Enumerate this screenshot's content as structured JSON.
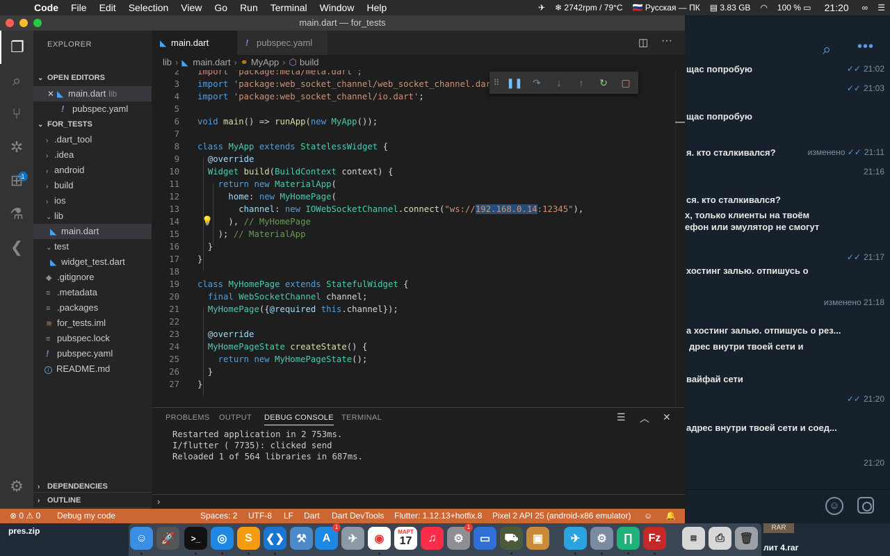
{
  "menubar": {
    "app": "Code",
    "items": [
      "File",
      "Edit",
      "Selection",
      "View",
      "Go",
      "Run",
      "Terminal",
      "Window",
      "Help"
    ],
    "fan": "2742rpm / 79°C",
    "lang": "Русская — ПК",
    "mem": "3.83 GB",
    "battery": "100 %",
    "clock": "21:20"
  },
  "window": {
    "title": "main.dart — for_tests"
  },
  "sidebar": {
    "title": "EXPLORER",
    "open_editors": "OPEN EDITORS",
    "open_items": [
      {
        "name": "main.dart",
        "hint": "lib"
      },
      {
        "name": "pubspec.yaml"
      }
    ],
    "project": "FOR_TESTS",
    "tree": [
      ".dart_tool",
      ".idea",
      "android",
      "build",
      "ios",
      "lib",
      "main.dart",
      "test",
      "widget_test.dart",
      ".gitignore",
      ".metadata",
      ".packages",
      "for_tests.iml",
      "pubspec.lock",
      "pubspec.yaml",
      "README.md"
    ],
    "outline": "OUTLINE",
    "dependencies": "DEPENDENCIES"
  },
  "activity": {
    "debug_badge": "1"
  },
  "tabs": {
    "main": "main.dart",
    "pubspec": "pubspec.yaml"
  },
  "breadcrumb": {
    "folder": "lib",
    "file": "main.dart",
    "class": "MyApp",
    "method": "build"
  },
  "editor": {
    "line_numbers": [
      "2",
      "3",
      "4",
      "5",
      "6",
      "7",
      "8",
      "9",
      "10",
      "11",
      "12",
      "13",
      "14",
      "15",
      "16",
      "17",
      "18",
      "19",
      "20",
      "21",
      "22",
      "23",
      "24",
      "25",
      "26",
      "27"
    ],
    "lines": {
      "l2": "import 'package:meta/meta.dart';",
      "l3_kw": "import",
      "l3_st": "'package:web_socket_channel/web_socket_channel.dart'",
      "l4_kw": "import",
      "l4_st": "'package:web_socket_channel/io.dart'",
      "l6_kw": "void",
      "l6_fn": "main",
      "l6_mid": "() => ",
      "l6_fn2": "runApp",
      "l6_kw2": "new",
      "l6_ty": "MyApp",
      "l8_kw": "class",
      "l8_ty": "MyApp",
      "l8_kw2": "extends",
      "l8_ty2": "StatelessWidget",
      "l9_at": "@override",
      "l10_ty": "Widget",
      "l10_fn": "build",
      "l10_ty2": "BuildContext",
      "l10_rest": " context) {",
      "l11_kw": "return",
      "l11_kw2": "new",
      "l11_ty": "MaterialApp",
      "l12_va": "home",
      "l12_kw": "new",
      "l12_ty": "MyHomePage",
      "l13_va": "channel",
      "l13_kw": "new",
      "l13_ty": "IOWebSocketChannel",
      "l13_fn": "connect",
      "l13_st1": "\"ws://",
      "l13_sel": "192.168.0.14",
      "l13_st2": ":12345\"",
      "l14_cm": "// MyHomePage",
      "l15_cm": "// MaterialApp",
      "l19_kw": "class",
      "l19_ty": "MyHomePage",
      "l19_kw2": "extends",
      "l19_ty2": "StatefulWidget",
      "l20_kw": "final",
      "l20_ty": "WebSocketChannel",
      "l20_rest": " channel;",
      "l21_ty": "MyHomePage",
      "l21_at": "@required",
      "l21_kw": "this",
      "l21_rest": ".channel});",
      "l23_at": "@override",
      "l24_ty": "MyHomePageState",
      "l24_fn": "createState",
      "l25_kw": "return",
      "l25_kw2": "new",
      "l25_ty": "MyHomePageState"
    }
  },
  "panel": {
    "tabs": [
      "PROBLEMS",
      "OUTPUT",
      "DEBUG CONSOLE",
      "TERMINAL"
    ],
    "console": [
      "Restarted application in 2 753ms.",
      "I/flutter ( 7735): clicked send",
      "Reloaded 1 of 564 libraries in 687ms."
    ]
  },
  "statusbar": {
    "problems": "⊗ 0 ⚠ 0",
    "debug": "Debug my code",
    "spaces": "Spaces: 2",
    "encoding": "UTF-8",
    "eol": "LF",
    "language": "Dart",
    "devtools": "Dart DevTools",
    "flutter": "Flutter: 1.12.13+hotfix.8",
    "device": "Pixel 2 API 25 (android-x86 emulator)"
  },
  "telegram": {
    "messages": [
      {
        "text": "щас попробую",
        "time": "21:02",
        "check": true
      },
      {
        "text": "",
        "time": "21:03",
        "check": true
      },
      {
        "text": "щас попробую",
        "time": "",
        "check": false
      },
      {
        "text": "я. кто сталкивался?",
        "time": "21:11",
        "edited": "изменено",
        "check": true
      },
      {
        "text": "",
        "time": "21:16",
        "check": false
      },
      {
        "text": "ся. кто сталкивался?",
        "time": "",
        "check": false
      },
      {
        "text": "х, только клиенты на твоём",
        "time": "",
        "check": false
      },
      {
        "text": "ефон или эмулятор не смогут",
        "time": "",
        "check": false
      },
      {
        "text": "",
        "time": "21:17",
        "check": true
      },
      {
        "text": "хостинг залью. отпишусь о",
        "time": "",
        "check": false
      },
      {
        "text": "",
        "time": "21:18",
        "edited": "изменено",
        "check": false
      },
      {
        "text": "а хостинг залью. отпишусь о рез...",
        "time": "",
        "check": false
      },
      {
        "text": "дрес внутри твоей сети и",
        "time": "",
        "check": false
      },
      {
        "text": "вайфай сети",
        "time": "",
        "check": false
      },
      {
        "text": "",
        "time": "21:20",
        "check": true
      },
      {
        "text": "адрес внутри твоей сети и соед...",
        "time": "",
        "check": false
      },
      {
        "text": "",
        "time": "21:20",
        "check": false
      }
    ]
  },
  "desktop": {
    "left_file": "pres.zip",
    "rar_label": "RAR",
    "rar_file": "лит 4.rar"
  },
  "dock": {
    "calendar_month": "МАРТ",
    "calendar_day": "17",
    "telegram_badge": "1",
    "settings_badge": "1"
  }
}
